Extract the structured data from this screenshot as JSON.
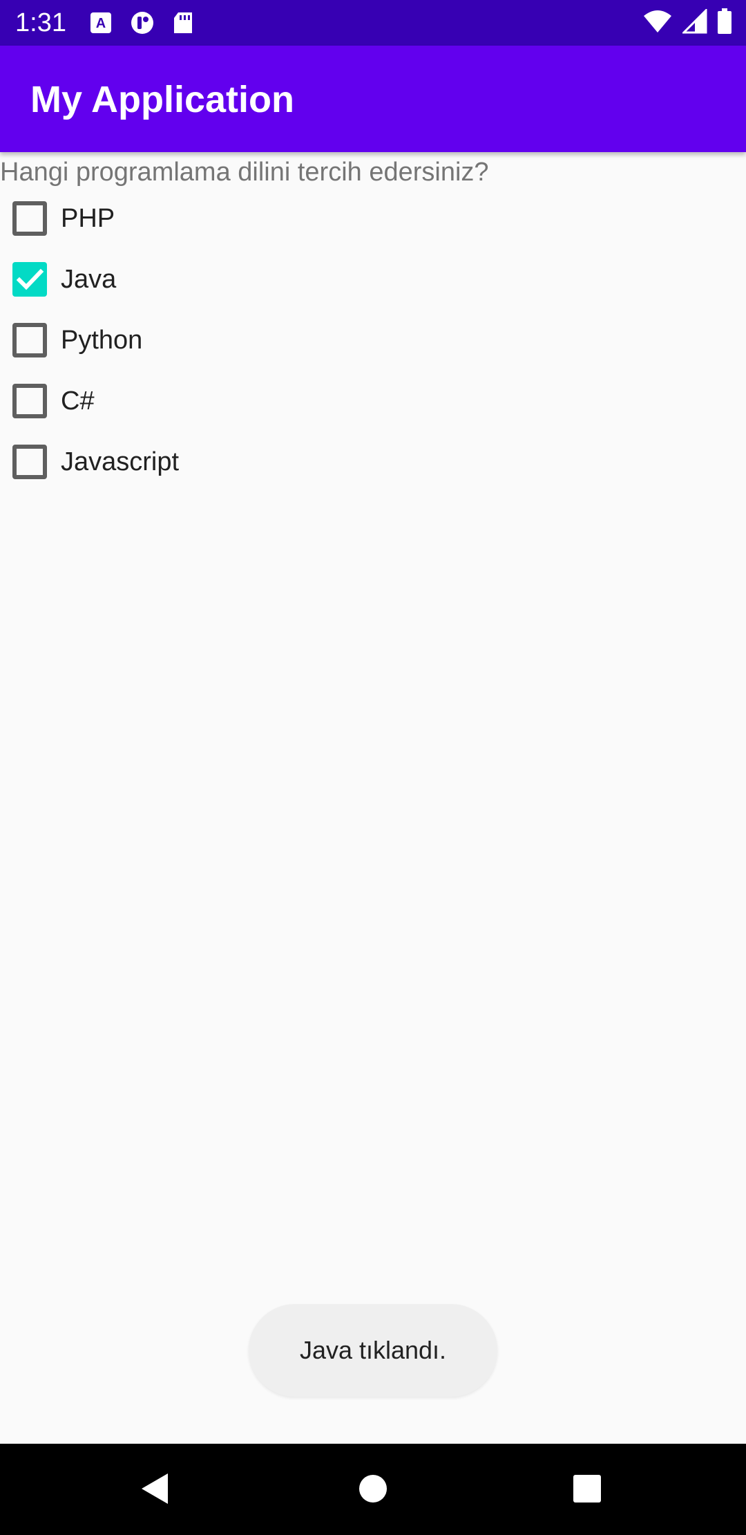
{
  "status_bar": {
    "time": "1:31",
    "left_icons": [
      "text-a-icon",
      "app-icon",
      "sd-card-icon"
    ],
    "right_icons": [
      "wifi-icon",
      "signal-icon",
      "battery-icon"
    ]
  },
  "app_bar": {
    "title": "My Application"
  },
  "content": {
    "question": "Hangi programlama dilini tercih edersiniz?",
    "options": [
      {
        "label": "PHP",
        "checked": false
      },
      {
        "label": "Java",
        "checked": true
      },
      {
        "label": "Python",
        "checked": false
      },
      {
        "label": "C#",
        "checked": false
      },
      {
        "label": "Javascript",
        "checked": false
      }
    ]
  },
  "toast": {
    "text": "Java tıklandı."
  },
  "nav_bar": {
    "buttons": [
      "back-icon",
      "home-icon",
      "recents-icon"
    ]
  },
  "colors": {
    "status_bar": "#3700b3",
    "app_bar": "#6200ee",
    "checkbox_checked": "#03dac5",
    "checkbox_unchecked_border": "#5f5f5f",
    "background": "#fafafa"
  }
}
